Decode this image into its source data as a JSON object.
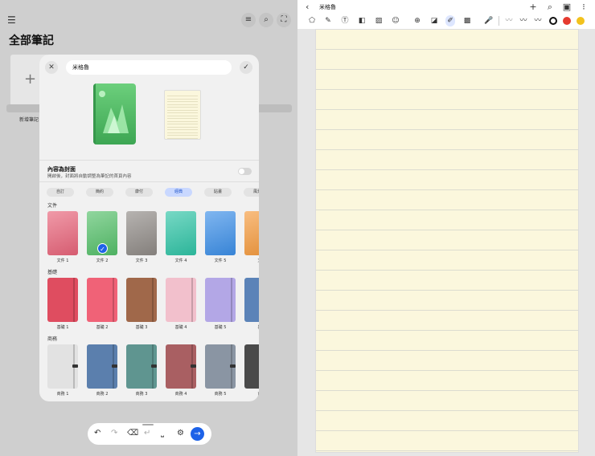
{
  "left": {
    "title": "全部筆記",
    "new_note_label": "新增筆記",
    "icons": [
      "list-icon",
      "search-icon",
      "expand-icon"
    ]
  },
  "dialog": {
    "note_name": "米格魯",
    "setting_title": "內容為封面",
    "setting_desc": "開啟後，封面將自動調整為筆記的首頁內容",
    "setting_enabled": false,
    "chips": [
      {
        "label": "自訂",
        "active": false
      },
      {
        "label": "簡約",
        "active": false
      },
      {
        "label": "康付",
        "active": false
      },
      {
        "label": "經典",
        "active": true
      },
      {
        "label": "貼畫",
        "active": false
      },
      {
        "label": "風景",
        "active": false
      }
    ],
    "sections": [
      {
        "label": "文件",
        "items": [
          {
            "caption": "文件 1",
            "color": "#e8647a",
            "selected": false
          },
          {
            "caption": "文件 2",
            "color": "#55c06a",
            "selected": true
          },
          {
            "caption": "文件 3",
            "color": "#8f8a86",
            "selected": false
          },
          {
            "caption": "文件 4",
            "color": "#2fc4a6",
            "selected": false
          },
          {
            "caption": "文件 5",
            "color": "#3c8fe8",
            "selected": false
          },
          {
            "caption": "文",
            "color": "#f59a3c",
            "selected": false
          }
        ]
      },
      {
        "label": "基礎",
        "items": [
          {
            "caption": "基礎 1",
            "color": "#df4d60",
            "selected": false
          },
          {
            "caption": "基礎 2",
            "color": "#f06277",
            "selected": false
          },
          {
            "caption": "基礎 3",
            "color": "#a0684a",
            "selected": false
          },
          {
            "caption": "基礎 4",
            "color": "#f2c0cc",
            "selected": false
          },
          {
            "caption": "基礎 5",
            "color": "#b3a7e6",
            "selected": false
          },
          {
            "caption": "基",
            "color": "#5b83b8",
            "selected": false
          }
        ]
      },
      {
        "label": "商務",
        "items": [
          {
            "caption": "商務 1",
            "color": "#e2e2e2",
            "selected": false
          },
          {
            "caption": "商務 2",
            "color": "#5b7fad",
            "selected": false
          },
          {
            "caption": "商務 3",
            "color": "#5f9590",
            "selected": false
          },
          {
            "caption": "商務 4",
            "color": "#a95f62",
            "selected": false
          },
          {
            "caption": "商務 5",
            "color": "#8a95a3",
            "selected": false
          },
          {
            "caption": "商",
            "color": "#4a4a4a",
            "selected": false
          }
        ]
      }
    ]
  },
  "bottom_toolbar": {
    "buttons": [
      "undo-icon",
      "redo-icon",
      "backspace-icon",
      "line-break-icon",
      "space-icon",
      "settings-icon",
      "send-icon"
    ]
  },
  "right": {
    "title": "米格魯",
    "pen_colors": [
      "#111111",
      "#e53a2f",
      "#f2c21d"
    ]
  }
}
